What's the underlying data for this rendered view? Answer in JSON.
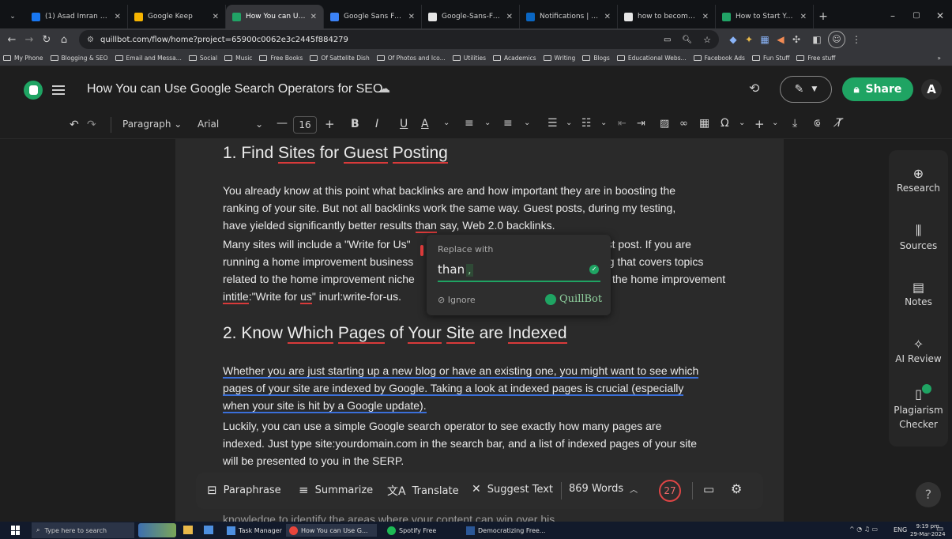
{
  "browser": {
    "tabs": [
      {
        "label": "(1) Asad Imran Shah -",
        "color": "#1877f2",
        "active": false
      },
      {
        "label": "Google Keep",
        "color": "#f6b400",
        "active": false
      },
      {
        "label": "How You can Use Goo",
        "color": "#21a366",
        "active": true
      },
      {
        "label": "Google Sans Font Fam",
        "color": "#3b82f6",
        "active": false
      },
      {
        "label": "Google-Sans-Font/Go",
        "color": "#e6e6e6",
        "active": false
      },
      {
        "label": "Notifications | LinkedI",
        "color": "#0a66c2",
        "active": false
      },
      {
        "label": "how to become conte",
        "color": "#e6e6e6",
        "active": false
      },
      {
        "label": "How to Start Your Car",
        "color": "#21a366",
        "active": false
      }
    ],
    "url": "quillbot.com/flow/home?project=65900c0062e3c2445f884279",
    "bookmarks": [
      "My Phone",
      "Blogging & SEO",
      "Email and Messa...",
      "Social",
      "Music",
      "Free Books",
      "Of Sattelite Dish",
      "Of Photos and Ico...",
      "Utilities",
      "Academics",
      "Writing",
      "Blogs",
      "Educational Webs...",
      "Facebook Ads",
      "Fun Stuff",
      "Free stuff"
    ]
  },
  "app": {
    "doc_title": "How You can Use Google Search Operators for SEO",
    "share_label": "Share",
    "avatar_letter": "A",
    "accent": "#1fa463"
  },
  "toolbar": {
    "style": "Paragraph",
    "font": "Arial",
    "font_size": "16"
  },
  "document": {
    "h1": "1. Find Sites for Guest Posting",
    "p1_l1": "You already know at this point what backlinks are and how important they are in boosting the",
    "p1_l2": "ranking of your site. But not all backlinks work the same way. Guest posts, during my testing,",
    "p1_l3_a": "have yielded significantly better results ",
    "p1_l3_b": "than",
    "p1_l3_c": " say, Web 2.0 backlinks.",
    "p2_l1_a": "Many sites will include a \"Write for Us\"",
    "p2_l1_b": "uest post. If you are",
    "p2_l2_a": "running a home improvement business",
    "p2_l2_b": "og that covers topics",
    "p2_l3_a": "related to the home improvement niche",
    "p2_l3_b": "the home improvement",
    "p2_l4_a": "intitle",
    "p2_l4_b": ":\"Write for ",
    "p2_l4_c": "us",
    "p2_l4_d": "\" inurl:write-for-us.",
    "h2_a": "2. Know ",
    "h2_b": "Which",
    "h2_c": " ",
    "h2_d": "Pages",
    "h2_e": " of ",
    "h2_f": "Your",
    "h2_g": " ",
    "h2_h": "Site",
    "h2_i": " are ",
    "h2_j": "Indexed",
    "p3_l1": "Whether you are just starting up a new blog or have an existing one, you might want to see which",
    "p3_l2": "pages of your site are indexed by Google. Taking a look at indexed pages is crucial (especially",
    "p3_l3": "when your site is hit by a Google update).",
    "p4_l1": "Luckily, you can use a simple Google search operator to see exactly how many pages are",
    "p4_l2": "indexed. Just type site:yourdomain.com in the search bar, and a list of indexed pages of your site",
    "p4_l3": "will be presented to you in the SERP.",
    "p5_l1": "knowledge to identify the areas where your content can win over his."
  },
  "popup": {
    "title": "Replace with",
    "suggestion": "than",
    "suggestion_suffix": ",",
    "ignore_label": "Ignore",
    "brand": "QuillBot"
  },
  "sidepanel": {
    "items": [
      "Research",
      "Sources",
      "Notes",
      "AI Review",
      "Plagiarism",
      "Checker"
    ]
  },
  "bottombar": {
    "paraphrase": "Paraphrase",
    "summarize": "Summarize",
    "translate": "Translate",
    "suggest": "Suggest Text",
    "word_count": "869 Words",
    "issues": "27"
  },
  "taskbar": {
    "search_placeholder": "Type here to search",
    "apps": [
      "Task Manager",
      "How You can Use G...",
      "Spotify Free",
      "Democratizing Free..."
    ],
    "lang": "ENG",
    "time": "9:19 pm",
    "date": "29-Mar-2024"
  }
}
